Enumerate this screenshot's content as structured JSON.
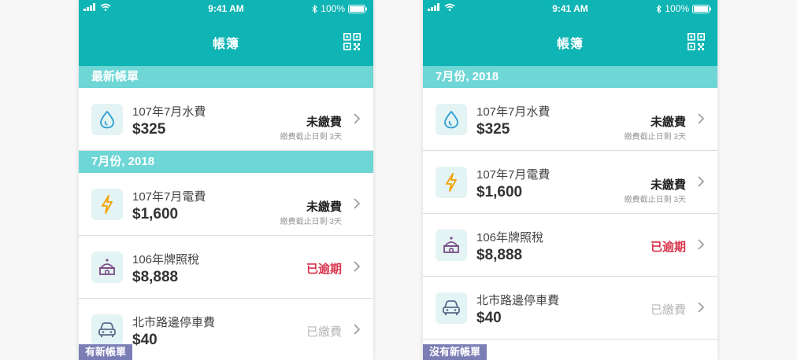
{
  "status_bar": {
    "time": "9:41 AM",
    "battery": "100%"
  },
  "nav": {
    "title": "帳簿",
    "qr_icon": "qr-code-icon"
  },
  "colors": {
    "header": "#0fb4b4",
    "section": "#6fd6d6",
    "overdue": "#d9334b",
    "tag": "#7b7eb5"
  },
  "left": {
    "section_latest": "最新帳單",
    "latest_bill": {
      "name": "107年7月水費",
      "amount": "$325",
      "status": "未繳費",
      "due": "繳費截止日剩 3天",
      "icon": "water-drop-icon"
    },
    "section_month": "7月份, 2018",
    "bills": [
      {
        "name": "107年7月電費",
        "amount": "$1,600",
        "status": "未繳費",
        "due": "繳費截止日剩 3天",
        "icon": "lightning-icon"
      },
      {
        "name": "106年牌照稅",
        "amount": "$8,888",
        "status": "已逾期",
        "icon": "government-building-icon"
      },
      {
        "name": "北市路邊停車費",
        "amount": "$40",
        "status": "已繳費",
        "icon": "car-icon"
      }
    ],
    "tag": "有新帳單"
  },
  "right": {
    "section_month": "7月份, 2018",
    "bills": [
      {
        "name": "107年7月水費",
        "amount": "$325",
        "status": "未繳費",
        "due": "繳費截止日剩 3天",
        "icon": "water-drop-icon"
      },
      {
        "name": "107年7月電費",
        "amount": "$1,600",
        "status": "未繳費",
        "due": "繳費截止日剩 3天",
        "icon": "lightning-icon"
      },
      {
        "name": "106年牌照稅",
        "amount": "$8,888",
        "status": "已逾期",
        "icon": "government-building-icon"
      },
      {
        "name": "北市路邊停車費",
        "amount": "$40",
        "status": "已繳費",
        "icon": "car-icon"
      }
    ],
    "tag": "沒有新帳單"
  }
}
